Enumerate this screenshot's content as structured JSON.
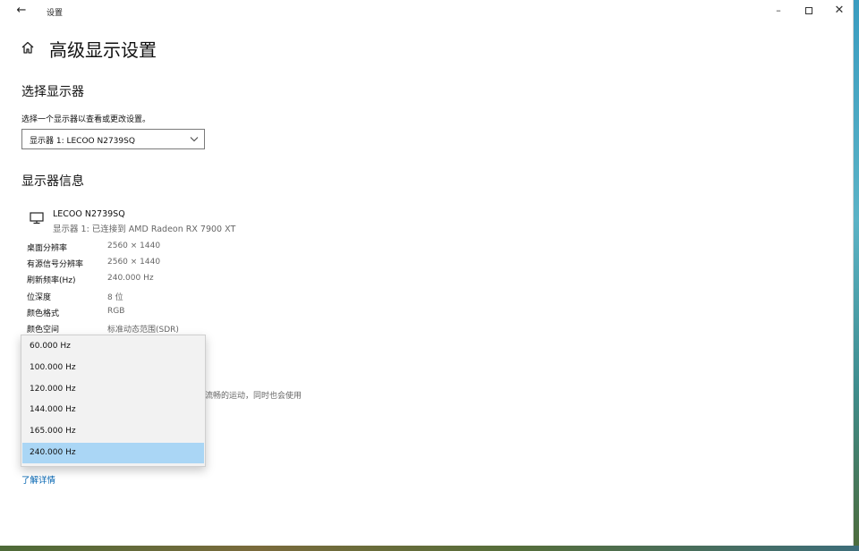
{
  "window": {
    "title": "设置",
    "back_label": "←",
    "minimize_label": "–",
    "close_label": "✕"
  },
  "page": {
    "title": "高级显示设置"
  },
  "select_display": {
    "heading": "选择显示器",
    "hint": "选择一个显示器以查看或更改设置。",
    "selected": "显示器 1: LECOO N2739SQ"
  },
  "display_info": {
    "heading": "显示器信息",
    "monitor_name": "LECOO N2739SQ",
    "monitor_connection": "显示器 1: 已连接到 AMD Radeon RX 7900 XT",
    "rows": [
      {
        "label": "桌面分辨率",
        "value": "2560 × 1440"
      },
      {
        "label": "有源信号分辨率",
        "value": "2560 × 1440"
      },
      {
        "label": "刷新频率(Hz)",
        "value": "240.000 Hz"
      },
      {
        "label": "位深度",
        "value": "8 位"
      },
      {
        "label": "颜色格式",
        "value": "RGB"
      },
      {
        "label": "颜色空间",
        "value": "标准动态范围(SDR)"
      }
    ]
  },
  "refresh_rate_dropdown": {
    "options": [
      "60.000 Hz",
      "100.000 Hz",
      "120.000 Hz",
      "144.000 Hz",
      "165.000 Hz",
      "240.000 Hz"
    ],
    "selected": "240.000 Hz"
  },
  "refresh_description_partial": "流畅的运动，同时也会使用",
  "learn_more": "了解详情",
  "colors": {
    "accent_link": "#0063b1",
    "selection": "#aad6f5"
  }
}
